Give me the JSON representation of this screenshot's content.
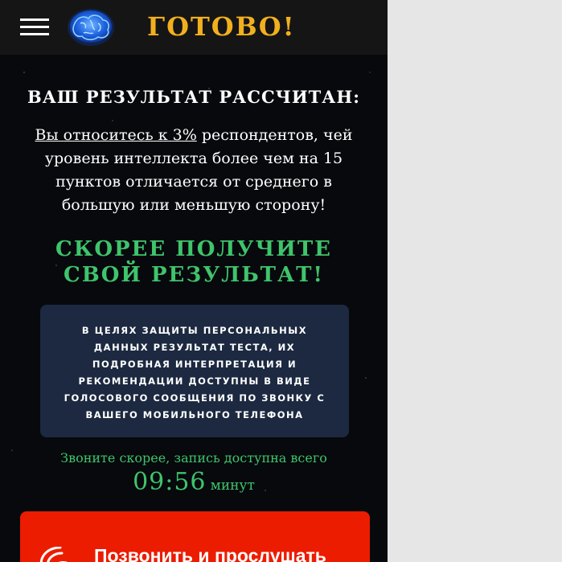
{
  "header": {
    "title": "ГОТОВО!",
    "logo_icon": "brain-icon",
    "menu_icon": "hamburger-menu-icon"
  },
  "result": {
    "heading": "ВАШ РЕЗУЛЬТАТ РАССЧИТАН:",
    "link_text": "Вы относитесь к 3%",
    "text": " респондентов, чей уровень интеллекта более чем на 15 пунктов отличается от среднего в большую или меньшую сторону!"
  },
  "cta": {
    "heading": "СКОРЕЕ ПОЛУЧИТЕ СВОЙ РЕЗУЛЬТАТ!"
  },
  "info": {
    "text": "В ЦЕЛЯХ ЗАЩИТЫ ПЕРСОНАЛЬНЫХ ДАННЫХ РЕЗУЛЬТАТ ТЕСТА, ИХ ПОДРОБНАЯ ИНТЕРПРЕТАЦИЯ И РЕКОМЕНДАЦИИ ДОСТУПНЫ В ВИДЕ ГОЛОСОВОГО СООБЩЕНИЯ ПО ЗВОНКУ С ВАШЕГО МОБИЛЬНОГО ТЕЛЕФОНА"
  },
  "timer": {
    "label": "Звоните скорее, запись доступна всего",
    "time": "09:56",
    "unit": "минут"
  },
  "call_button": {
    "label": "Позвонить и прослушать",
    "icon": "phone-ringing-icon"
  },
  "colors": {
    "accent_gold": "#f2b01e",
    "accent_green": "#3fc46b",
    "button_red": "#ec1c00",
    "info_box": "#1c2940"
  }
}
